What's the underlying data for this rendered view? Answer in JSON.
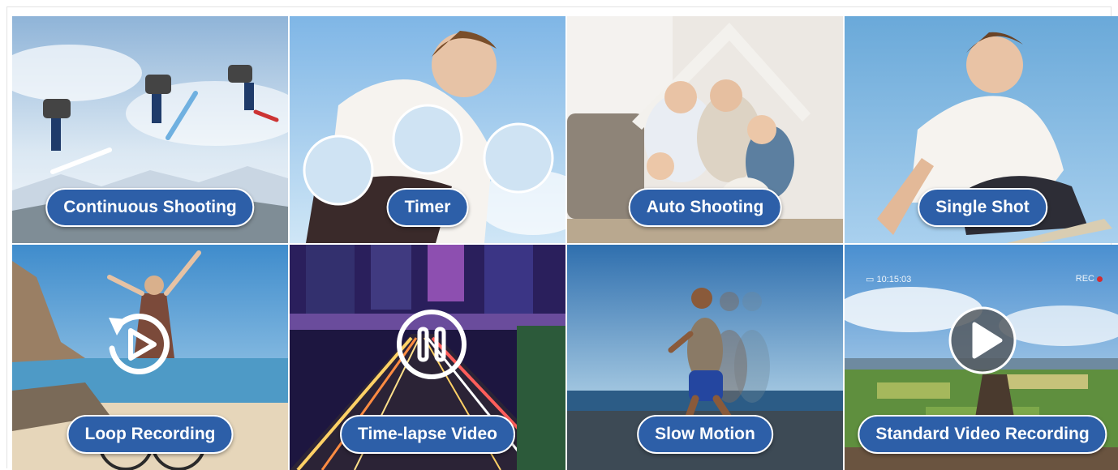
{
  "tiles": [
    {
      "id": "continuous-shooting",
      "label": "Continuous Shooting"
    },
    {
      "id": "timer",
      "label": "Timer"
    },
    {
      "id": "auto-shooting",
      "label": "Auto Shooting"
    },
    {
      "id": "single-shot",
      "label": "Single Shot"
    },
    {
      "id": "loop-recording",
      "label": "Loop Recording"
    },
    {
      "id": "time-lapse-video",
      "label": "Time-lapse Video"
    },
    {
      "id": "slow-motion",
      "label": "Slow Motion"
    },
    {
      "id": "standard-video-recording",
      "label": "Standard Video Recording"
    }
  ],
  "hud": {
    "time": "10:15:03",
    "rec": "REC"
  },
  "icons": {
    "loop": "loop-replay-icon",
    "pause": "pause-icon",
    "play": "play-icon"
  },
  "colors": {
    "pill": "#2d5fa8",
    "pill_border": "#ffffff"
  }
}
